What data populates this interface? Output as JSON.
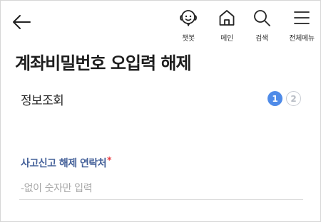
{
  "header": {
    "nav": [
      {
        "icon": "chatbot-icon",
        "label": "챗봇"
      },
      {
        "icon": "home-icon",
        "label": "메인"
      },
      {
        "icon": "search-icon",
        "label": "검색"
      },
      {
        "icon": "menu-icon",
        "label": "전체메뉴"
      }
    ]
  },
  "page": {
    "title": "계좌비밀번호 오입력 해제"
  },
  "section": {
    "title": "정보조회",
    "steps": [
      "1",
      "2"
    ],
    "current_step": "1"
  },
  "form": {
    "contact": {
      "label": "사고신고 해제 연락처",
      "required_mark": "*",
      "placeholder": "-없이 숫자만 입력",
      "value": ""
    }
  },
  "colors": {
    "accent": "#4f8be8",
    "label": "#46629a",
    "required": "#e8383d",
    "placeholder": "#a8a8a8"
  }
}
